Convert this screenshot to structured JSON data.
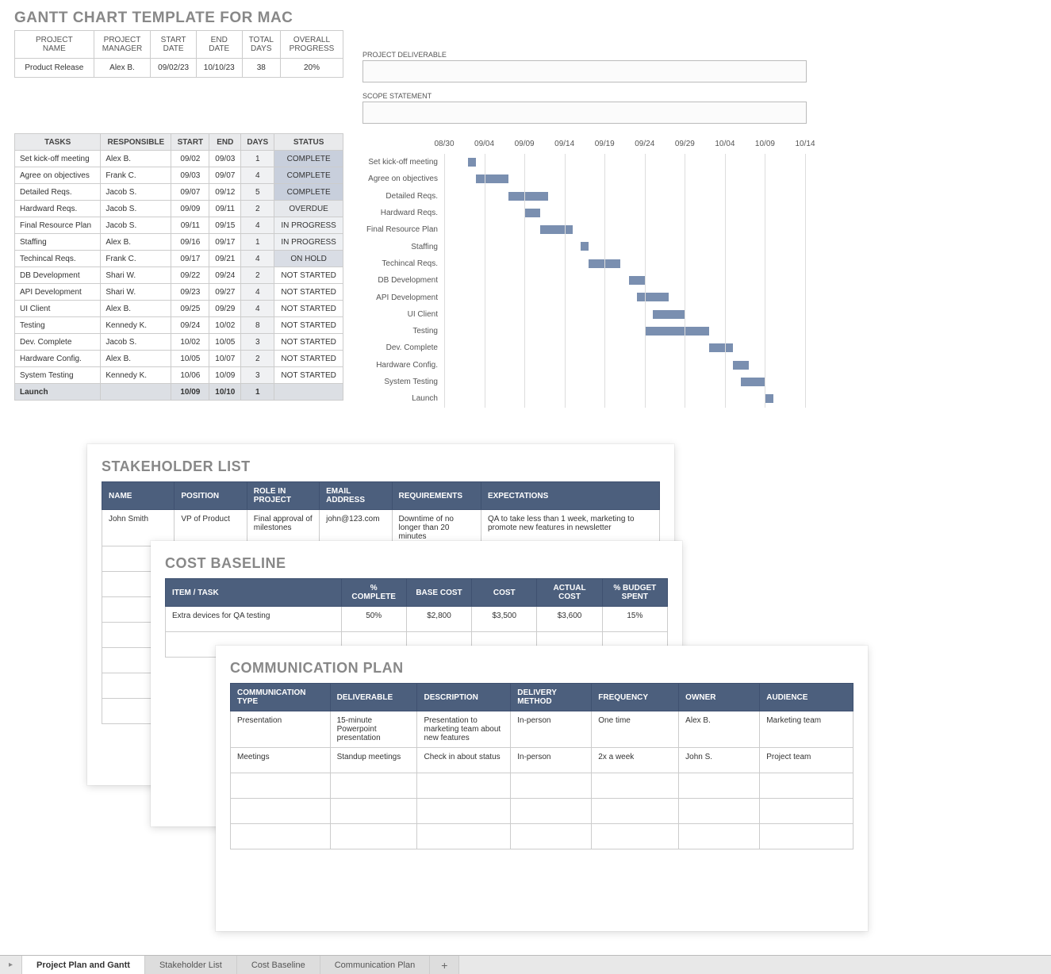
{
  "title": "GANTT CHART TEMPLATE FOR MAC",
  "summary_headers": [
    "PROJECT\nNAME",
    "PROJECT\nMANAGER",
    "START\nDATE",
    "END\nDATE",
    "TOTAL\nDAYS",
    "OVERALL\nPROGRESS"
  ],
  "summary_values": [
    "Product Release",
    "Alex B.",
    "09/02/23",
    "10/10/23",
    "38",
    "20%"
  ],
  "deliverable_label": "PROJECT DELIVERABLE",
  "scope_label": "SCOPE STATEMENT",
  "tasks_headers": [
    "TASKS",
    "RESPONSIBLE",
    "START",
    "END",
    "DAYS",
    "STATUS"
  ],
  "tasks": [
    {
      "task": "Set kick-off meeting",
      "resp": "Alex B.",
      "start": "09/02",
      "end": "09/03",
      "days": "1",
      "status": "COMPLETE",
      "sclass": "st-complete"
    },
    {
      "task": "Agree on objectives",
      "resp": "Frank C.",
      "start": "09/03",
      "end": "09/07",
      "days": "4",
      "status": "COMPLETE",
      "sclass": "st-complete"
    },
    {
      "task": "Detailed Reqs.",
      "resp": "Jacob S.",
      "start": "09/07",
      "end": "09/12",
      "days": "5",
      "status": "COMPLETE",
      "sclass": "st-complete"
    },
    {
      "task": "Hardward Reqs.",
      "resp": "Jacob S.",
      "start": "09/09",
      "end": "09/11",
      "days": "2",
      "status": "OVERDUE",
      "sclass": "st-overdue"
    },
    {
      "task": "Final Resource Plan",
      "resp": "Jacob S.",
      "start": "09/11",
      "end": "09/15",
      "days": "4",
      "status": "IN PROGRESS",
      "sclass": "st-progress"
    },
    {
      "task": "Staffing",
      "resp": "Alex B.",
      "start": "09/16",
      "end": "09/17",
      "days": "1",
      "status": "IN PROGRESS",
      "sclass": "st-progress"
    },
    {
      "task": "Techincal Reqs.",
      "resp": "Frank C.",
      "start": "09/17",
      "end": "09/21",
      "days": "4",
      "status": "ON HOLD",
      "sclass": "st-hold"
    },
    {
      "task": "DB Development",
      "resp": "Shari W.",
      "start": "09/22",
      "end": "09/24",
      "days": "2",
      "status": "NOT STARTED",
      "sclass": ""
    },
    {
      "task": "API Development",
      "resp": "Shari W.",
      "start": "09/23",
      "end": "09/27",
      "days": "4",
      "status": "NOT STARTED",
      "sclass": ""
    },
    {
      "task": "UI Client",
      "resp": "Alex B.",
      "start": "09/25",
      "end": "09/29",
      "days": "4",
      "status": "NOT STARTED",
      "sclass": ""
    },
    {
      "task": "Testing",
      "resp": "Kennedy K.",
      "start": "09/24",
      "end": "10/02",
      "days": "8",
      "status": "NOT STARTED",
      "sclass": ""
    },
    {
      "task": "Dev. Complete",
      "resp": "Jacob S.",
      "start": "10/02",
      "end": "10/05",
      "days": "3",
      "status": "NOT STARTED",
      "sclass": ""
    },
    {
      "task": "Hardware Config.",
      "resp": "Alex B.",
      "start": "10/05",
      "end": "10/07",
      "days": "2",
      "status": "NOT STARTED",
      "sclass": ""
    },
    {
      "task": "System Testing",
      "resp": "Kennedy K.",
      "start": "10/06",
      "end": "10/09",
      "days": "3",
      "status": "NOT STARTED",
      "sclass": ""
    },
    {
      "task": "Launch",
      "resp": "",
      "start": "10/09",
      "end": "10/10",
      "days": "1",
      "status": "",
      "sclass": "",
      "launch": true
    }
  ],
  "chart_data": {
    "type": "bar",
    "orientation": "horizontal-gantt",
    "x_ticks": [
      "08/30",
      "09/04",
      "09/09",
      "09/14",
      "09/19",
      "09/24",
      "09/29",
      "10/04",
      "10/09",
      "10/14"
    ],
    "x_domain_days": [
      "08/30",
      "10/14"
    ],
    "series": [
      {
        "name": "Set kick-off meeting",
        "start": "09/02",
        "end": "09/03"
      },
      {
        "name": "Agree on objectives",
        "start": "09/03",
        "end": "09/07"
      },
      {
        "name": "Detailed Reqs.",
        "start": "09/07",
        "end": "09/12"
      },
      {
        "name": "Hardward Reqs.",
        "start": "09/09",
        "end": "09/11"
      },
      {
        "name": "Final Resource Plan",
        "start": "09/11",
        "end": "09/15"
      },
      {
        "name": "Staffing",
        "start": "09/16",
        "end": "09/17"
      },
      {
        "name": "Techincal Reqs.",
        "start": "09/17",
        "end": "09/21"
      },
      {
        "name": "DB Development",
        "start": "09/22",
        "end": "09/24"
      },
      {
        "name": "API Development",
        "start": "09/23",
        "end": "09/27"
      },
      {
        "name": "UI Client",
        "start": "09/25",
        "end": "09/29"
      },
      {
        "name": "Testing",
        "start": "09/24",
        "end": "10/02"
      },
      {
        "name": "Dev. Complete",
        "start": "10/02",
        "end": "10/05"
      },
      {
        "name": "Hardware Config.",
        "start": "10/05",
        "end": "10/07"
      },
      {
        "name": "System Testing",
        "start": "10/06",
        "end": "10/09"
      },
      {
        "name": "Launch",
        "start": "10/09",
        "end": "10/10"
      }
    ]
  },
  "stakeholder": {
    "title": "STAKEHOLDER LIST",
    "headers": [
      "NAME",
      "POSITION",
      "ROLE IN PROJECT",
      "EMAIL ADDRESS",
      "REQUIREMENTS",
      "EXPECTATIONS"
    ],
    "row": [
      "John Smith",
      "VP of Product",
      "Final approval of milestones",
      "john@123.com",
      "Downtime of no longer than 20 minutes",
      "QA to take less than 1 week, marketing to promote new features in newsletter"
    ]
  },
  "cost": {
    "title": "COST BASELINE",
    "headers": [
      "ITEM / TASK",
      "% COMPLETE",
      "BASE COST",
      "COST",
      "ACTUAL COST",
      "% BUDGET SPENT"
    ],
    "row": [
      "Extra devices for QA testing",
      "50%",
      "$2,800",
      "$3,500",
      "$3,600",
      "15%"
    ]
  },
  "comm": {
    "title": "COMMUNICATION PLAN",
    "headers": [
      "COMMUNICATION TYPE",
      "DELIVERABLE",
      "DESCRIPTION",
      "DELIVERY METHOD",
      "FREQUENCY",
      "OWNER",
      "AUDIENCE"
    ],
    "rows": [
      [
        "Presentation",
        "15-minute Powerpoint presentation",
        "Presentation to marketing team about new features",
        "In-person",
        "One time",
        "Alex B.",
        "Marketing team"
      ],
      [
        "Meetings",
        "Standup meetings",
        "Check in about status",
        "In-person",
        "2x a week",
        "John S.",
        "Project team"
      ]
    ]
  },
  "tabs": [
    "Project Plan and Gantt",
    "Stakeholder List",
    "Cost Baseline",
    "Communication Plan"
  ],
  "active_tab": 0,
  "plus": "+"
}
